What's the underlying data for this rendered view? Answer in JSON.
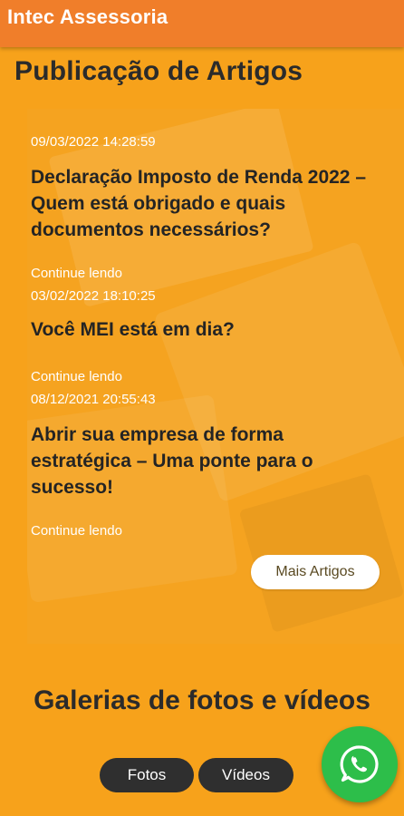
{
  "appbar": {
    "title": "Intec Assessoria"
  },
  "articles_section": {
    "title": "Publicação de Artigos",
    "items": [
      {
        "date": "09/03/2022 14:28:59",
        "title": "Declaração Imposto de Renda 2022 – Quem está obrigado e quais documentos necessários?",
        "more": "Continue lendo"
      },
      {
        "date": "03/02/2022 18:10:25",
        "title": "Você MEI está em dia?",
        "more": "Continue lendo"
      },
      {
        "date": "08/12/2021 20:55:43",
        "title": "Abrir sua empresa de forma estratégica – Uma ponte para o sucesso!",
        "more": "Continue lendo"
      }
    ],
    "more_button": "Mais Artigos"
  },
  "gallery": {
    "title": "Galerias de fotos e vídeos",
    "photos_button": "Fotos",
    "videos_button": "Vídeos"
  },
  "fab": {
    "icon": "whatsapp-icon",
    "color": "#2DBE4A"
  },
  "colors": {
    "appbar": "#F07E2A",
    "background": "#F7A21B"
  }
}
